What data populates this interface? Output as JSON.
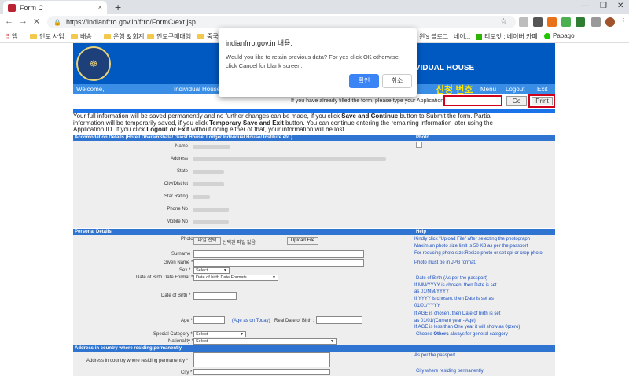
{
  "browser": {
    "tab_title": "Form C",
    "tab_close": "×",
    "new_tab": "+",
    "url": "https://indianfrro.gov.in/frro/FormC/ext.jsp",
    "bookmarks": [
      "앱",
      "인도 사업",
      "배송",
      "은행 & 회계",
      "인도구매대행",
      "중국구",
      "윈's 블로그 : 네이...",
      "티모잇 : 네이버 카페",
      "Papago"
    ]
  },
  "site": {
    "title_part": "IVIDUAL HOUSE",
    "nav": {
      "welcome": "Welcome,",
      "individual_house": "Individual House:",
      "menu": "Menu",
      "logout": "Logout",
      "exit": "Exit"
    },
    "korean_label": "신청 번호",
    "appid_prompt": "If you have already filled the form, please type your Application ID",
    "go": "Go",
    "print": "Print"
  },
  "info": {
    "line1_a": "Your full information will be saved permanently and no further changes can be made, if you click ",
    "line1_b": "Save and Continue",
    "line1_c": " button to Submit the form. Partial",
    "line2_a": "information will be temporarily saved, if you click ",
    "line2_b": "Temporary Save and Exit",
    "line2_c": " button. You can continue entering the remaining information later using the",
    "line3_a": "Application ID. If you click ",
    "line3_b": "Logout or Exit",
    "line3_c": " without doing either of that, your information will be lost."
  },
  "accommodation": {
    "header": "Accomodation Details (Hotel/ DharamShala/ Guest House/ Lodge/ Individual House/ Institute etc.)",
    "photo_header": "Photo",
    "fields": [
      "Name",
      "Address",
      "State",
      "City/District",
      "Star Rating",
      "Phone No",
      "Mobile No"
    ]
  },
  "personal": {
    "header": "Personal Details",
    "help_header": "Help",
    "photo_label": "Photo",
    "file_btn": "파일 선택",
    "no_file": "선택된 파일 없음",
    "upload_btn": "Upload File",
    "surname": "Surname",
    "given_name": "Given Name *",
    "sex": "Sex *",
    "dob_format": "Date of Birth Date Format *",
    "dob": "Date of Birth *",
    "age": "Age *",
    "age_as_on": "(Age as on Today)",
    "real_dob": "Real Date of Birth :",
    "special_category": "Special Category *",
    "nationality": "Nationality *",
    "select": "Select",
    "dob_format_select": "Date of birth Date Formats",
    "help": [
      "Kindly click \"Upload File\" after selecting the photograph",
      "Maximum photo size limit is 50 KB as per the passport",
      "For reducing photo size:Resize photo or set dpi or crop photo",
      "Photo must be in JPG format.",
      "Date of Birth (As per the passport)",
      "If MM/YYYY is chosen, then Date is set",
      "as 01/MM/YYYY",
      "If YYYY is chosen, then Date is set as",
      "01/01/YYYY",
      "If AGE is chosen, then Date of birth is set",
      "as 01/01/(Current year - Age)",
      "If AGE is less than One year it will show as 0(zero)"
    ],
    "choose_a": "Choose ",
    "choose_b": "Others",
    "choose_c": " always for general category"
  },
  "address": {
    "header": "Address in country where residing permanently",
    "addr_label": "Address in country where residing permanently *",
    "city_label": "City *",
    "help1": "As per the passport",
    "help2": "City where residing permanently"
  },
  "dialog": {
    "title": "indianfrro.gov.in 내용:",
    "message": "Would you like to retain previous data? For yes click OK otherwise click Cancel for blank screen.",
    "ok": "확인",
    "cancel": "취소"
  }
}
